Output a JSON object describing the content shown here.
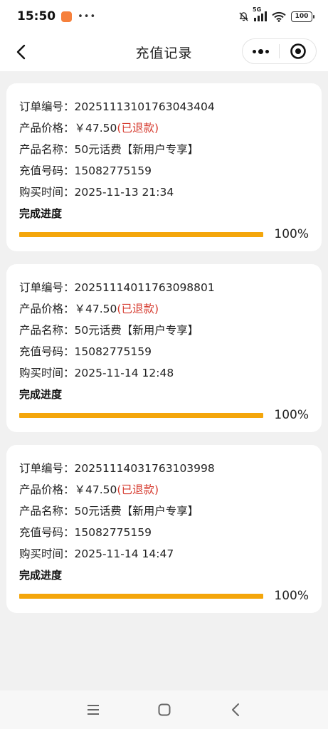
{
  "status_bar": {
    "time": "15:50",
    "network": "5G",
    "battery": "100"
  },
  "nav": {
    "title": "充值记录"
  },
  "labels": {
    "order_no": "订单编号：",
    "price": "产品价格：",
    "product": "产品名称：",
    "phone": "充值号码：",
    "time": "购买时间：",
    "progress": "完成进度"
  },
  "orders": [
    {
      "order_no": "20251113101763043404",
      "price": "￥47.50",
      "refund": "(已退款)",
      "product": "50元话费【新用户专享】",
      "phone": "15082775159",
      "time": "2025-11-13 21:34",
      "progress": 1.0,
      "progress_text": "100%"
    },
    {
      "order_no": "20251114011763098801",
      "price": "￥47.50",
      "refund": "(已退款)",
      "product": "50元话费【新用户专享】",
      "phone": "15082775159",
      "time": "2025-11-14 12:48",
      "progress": 1.0,
      "progress_text": "100%"
    },
    {
      "order_no": "20251114031763103998",
      "price": "￥47.50",
      "refund": "(已退款)",
      "product": "50元话费【新用户专享】",
      "phone": "15082775159",
      "time": "2025-11-14 14:47",
      "progress": 1.0,
      "progress_text": "100%"
    }
  ],
  "colors": {
    "progress_fill": "#f4a60b",
    "refund_text": "#d63b2f"
  },
  "icons": [
    "back-arrow-icon",
    "more-dots-icon",
    "close-target-icon",
    "menu-icon",
    "home-icon",
    "back-icon"
  ]
}
